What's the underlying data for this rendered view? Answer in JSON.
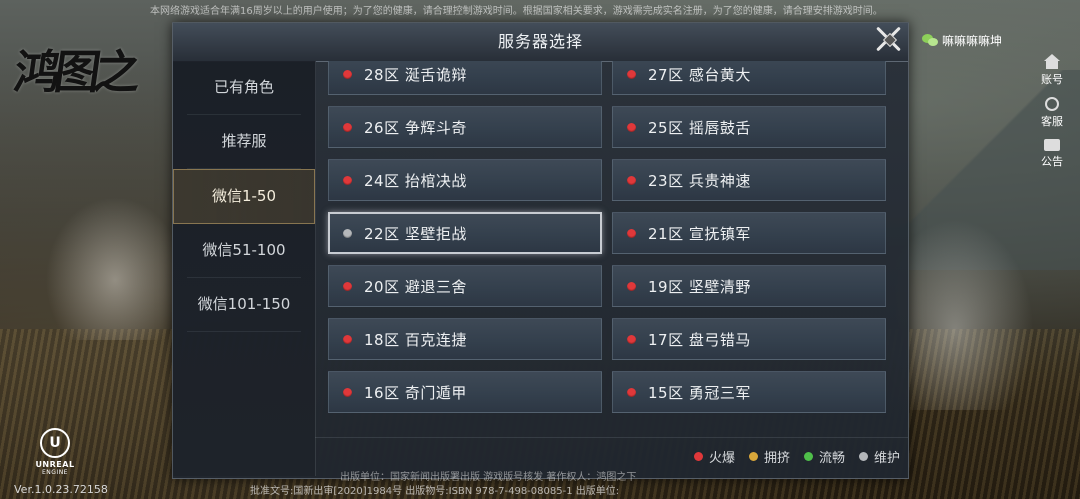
{
  "notices": {
    "top": "本网络游戏适合年满16周岁以上的用户使用；为了您的健康，请合理控制游戏时间。根据国家相关要求，游戏需完成实名注册，为了您的健康，请合理安排游戏时间。",
    "bottom_line1": "出版单位：国家新闻出版署出版 游戏版号核发 著作权人：鸿图之下",
    "bottom_line2": "批准文号:国新出审[2020]1984号    出版物号:ISBN 978-7-498-08085-1    出版单位:"
  },
  "version": "Ver.1.0.23.72158",
  "logo_text": "鸿图之",
  "engine": {
    "line1": "UNREAL",
    "line2": "ENGINE",
    "mark": "U"
  },
  "user": {
    "name": "嘛嘛嘛嘛坤",
    "icon": "wechat-icon"
  },
  "side_menu": [
    {
      "label": "账号",
      "icon": "home-icon"
    },
    {
      "label": "客服",
      "icon": "customer-service-icon"
    },
    {
      "label": "公告",
      "icon": "chat-bubble-icon"
    }
  ],
  "dialog": {
    "title": "服务器选择",
    "close_icon": "close-icon",
    "tabs": [
      {
        "label": "已有角色",
        "active": false
      },
      {
        "label": "推荐服",
        "active": false
      },
      {
        "label": "微信1-50",
        "active": true
      },
      {
        "label": "微信51-100",
        "active": false
      },
      {
        "label": "微信101-150",
        "active": false
      }
    ],
    "servers": [
      {
        "label": "28区 涎舌诡辩",
        "status": "hot",
        "selected": false
      },
      {
        "label": "27区 感台黄大",
        "status": "hot",
        "selected": false
      },
      {
        "label": "26区 争辉斗奇",
        "status": "hot",
        "selected": false
      },
      {
        "label": "25区 摇唇鼓舌",
        "status": "hot",
        "selected": false
      },
      {
        "label": "24区 抬棺决战",
        "status": "hot",
        "selected": false
      },
      {
        "label": "23区 兵贵神速",
        "status": "hot",
        "selected": false
      },
      {
        "label": "22区 坚壁拒战",
        "status": "maintenance",
        "selected": true
      },
      {
        "label": "21区 宣抚镇军",
        "status": "hot",
        "selected": false
      },
      {
        "label": "20区 避退三舍",
        "status": "hot",
        "selected": false
      },
      {
        "label": "19区 坚壁清野",
        "status": "hot",
        "selected": false
      },
      {
        "label": "18区 百克连捷",
        "status": "hot",
        "selected": false
      },
      {
        "label": "17区 盘弓错马",
        "status": "hot",
        "selected": false
      },
      {
        "label": "16区 奇门遁甲",
        "status": "hot",
        "selected": false
      },
      {
        "label": "15区 勇冠三军",
        "status": "hot",
        "selected": false
      }
    ],
    "legend": [
      {
        "label": "火爆",
        "status": "hot"
      },
      {
        "label": "拥挤",
        "status": "crowded"
      },
      {
        "label": "流畅",
        "status": "smooth"
      },
      {
        "label": "维护",
        "status": "maintenance"
      }
    ]
  },
  "colors": {
    "hot": "#e0383a",
    "crowded": "#d9a73a",
    "smooth": "#4fbf4a",
    "maintenance": "#b5b8bb"
  }
}
